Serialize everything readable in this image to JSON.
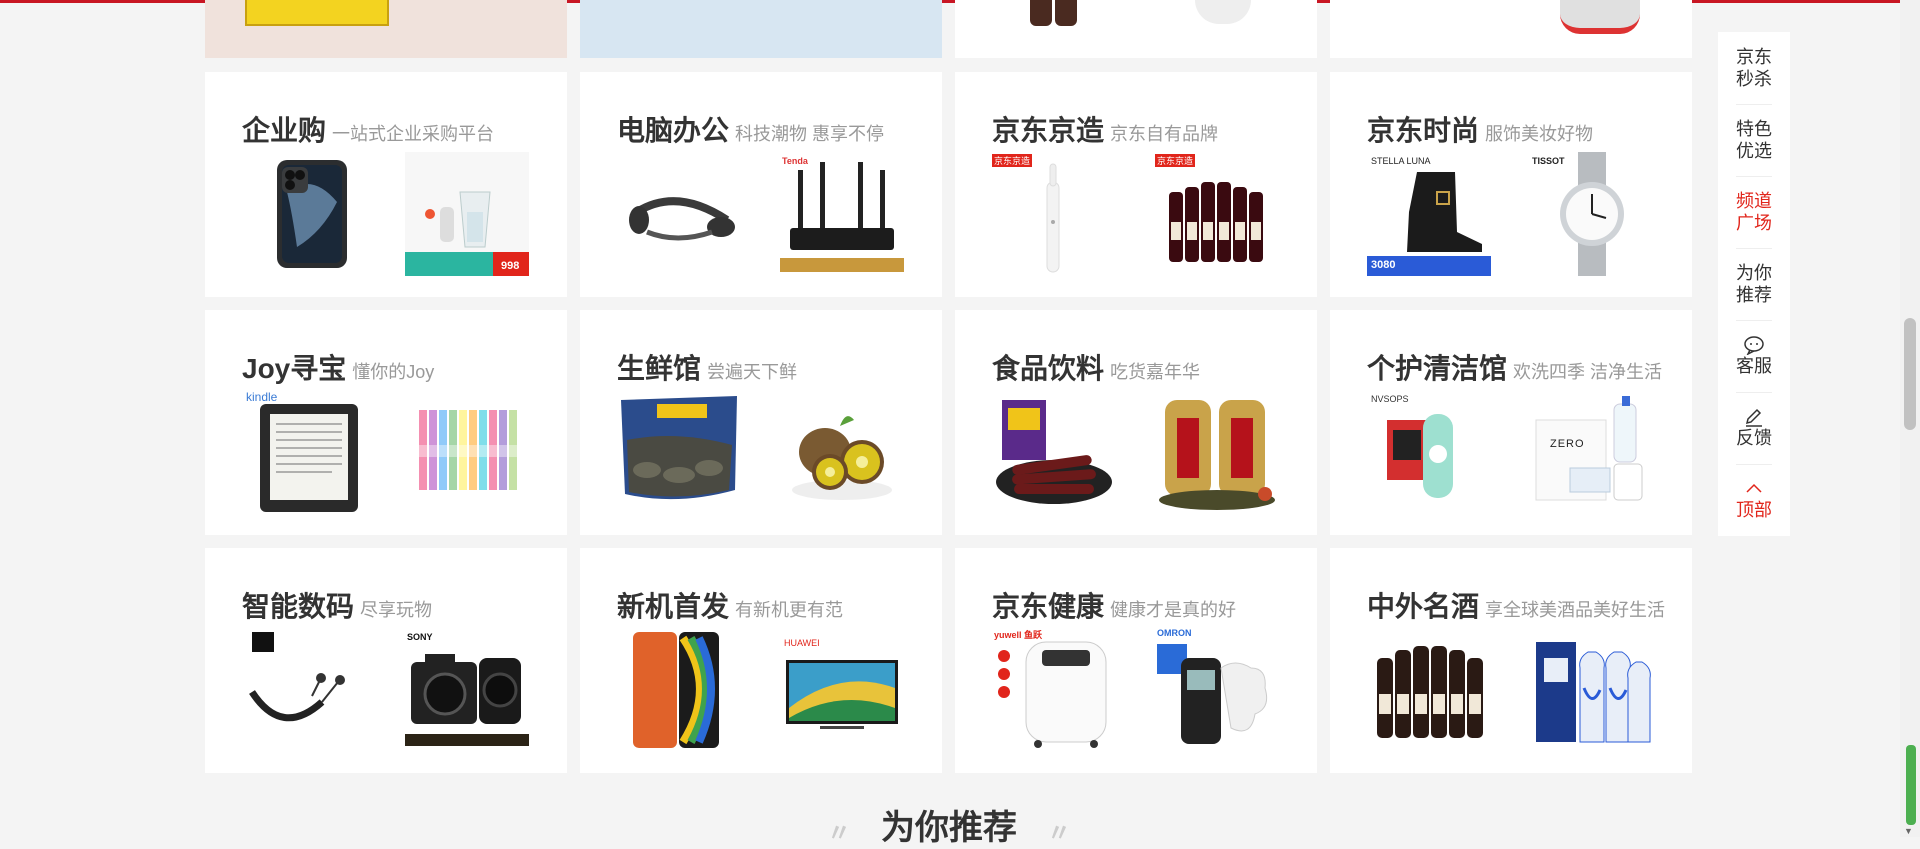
{
  "channels": [
    {
      "name": "企业购",
      "subtitle": "一站式企业采购平台",
      "left_icon": "smartphone-icon",
      "right_icon": "water-flosser-icon",
      "right_price": "998"
    },
    {
      "name": "电脑办公",
      "subtitle": "科技潮物 惠享不停",
      "left_icon": "headphones-icon",
      "right_icon": "router-icon",
      "right_brand": "Tenda"
    },
    {
      "name": "京东京造",
      "subtitle": "京东自有品牌",
      "left_icon": "electric-toothbrush-icon",
      "right_icon": "wine-bottles-icon",
      "left_brand": "京东京造",
      "right_brand": "京东京造"
    },
    {
      "name": "京东时尚",
      "subtitle": "服饰美妆好物",
      "left_icon": "boot-icon",
      "right_icon": "watch-icon",
      "left_brand": "STELLA LUNA",
      "right_brand": "TISSOT",
      "left_price": "3080"
    },
    {
      "name": "Joy寻宝",
      "subtitle": "懂你的Joy",
      "left_icon": "ereader-icon",
      "right_icon": "pens-icon",
      "left_brand": "kindle"
    },
    {
      "name": "生鲜馆",
      "subtitle": "尝遍天下鲜",
      "left_icon": "seafood-bag-icon",
      "right_icon": "kiwi-icon"
    },
    {
      "name": "食品饮料",
      "subtitle": "吃货嘉年华",
      "left_icon": "beef-jerky-icon",
      "right_icon": "tea-cans-icon"
    },
    {
      "name": "个护清洁馆",
      "subtitle": "欢洗四季 洁净生活",
      "left_icon": "deodorant-icon",
      "right_icon": "skincare-set-icon",
      "left_brand": "NVSOPS",
      "right_brand": "ZERO"
    },
    {
      "name": "智能数码",
      "subtitle": "尽享玩物",
      "left_icon": "neckband-earphones-icon",
      "right_icon": "camera-icon",
      "right_brand": "SONY"
    },
    {
      "name": "新机首发",
      "subtitle": "有新机更有范",
      "left_icon": "smartphone-orange-icon",
      "right_icon": "tv-icon",
      "right_brand": "HUAWEI"
    },
    {
      "name": "京东健康",
      "subtitle": "健康才是真的好",
      "left_icon": "oxygen-concentrator-icon",
      "right_icon": "massager-icon",
      "left_brand": "yuwell 鱼跃",
      "right_brand": "OMRON"
    },
    {
      "name": "中外名酒",
      "subtitle": "享全球美酒品美好生活",
      "left_icon": "beer-bottles-icon",
      "right_icon": "baijiu-bottles-icon"
    }
  ],
  "section_heading": "为你推荐",
  "side_nav": [
    {
      "label": "京东秒杀",
      "state": "normal"
    },
    {
      "label": "特色优选",
      "state": "normal"
    },
    {
      "label": "频道广场",
      "state": "active"
    },
    {
      "label": "为你推荐",
      "state": "normal"
    },
    {
      "label": "客服",
      "icon": "chat-bubble-icon",
      "state": "normal"
    },
    {
      "label": "反馈",
      "icon": "pen-icon",
      "state": "normal"
    },
    {
      "label": "顶部",
      "icon": "chevron-up-icon",
      "state": "red"
    }
  ],
  "colors": {
    "accent": "#e1251b",
    "page_bg": "#f4f4f4",
    "card_bg": "#ffffff"
  }
}
